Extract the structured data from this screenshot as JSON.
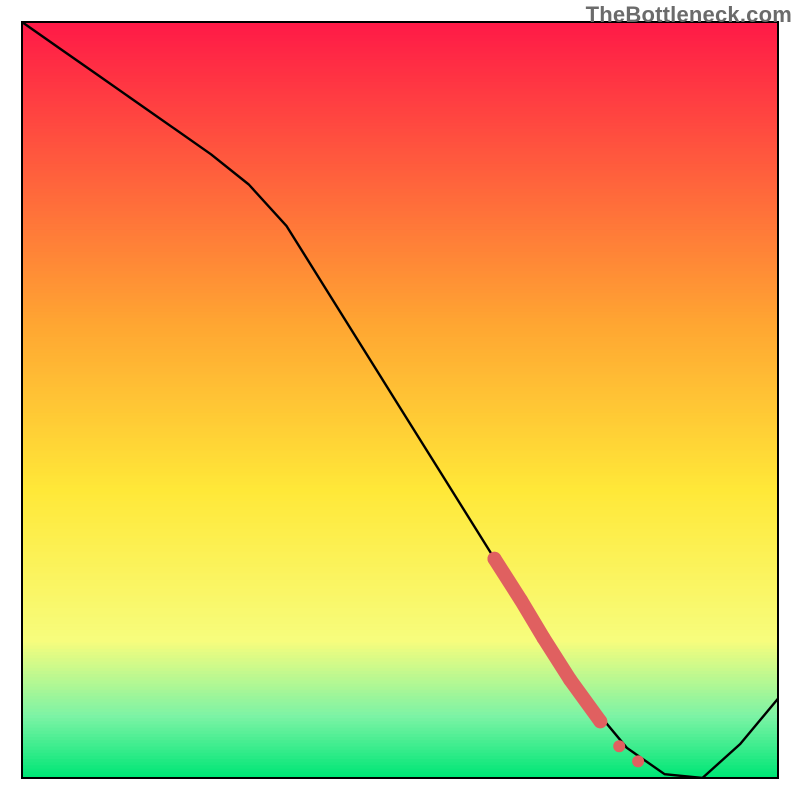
{
  "watermark": "TheBottleneck.com",
  "colors": {
    "top_red": "#ff1a47",
    "orange": "#ffa632",
    "yellow": "#ffe838",
    "pale_yellow": "#f7fd7d",
    "mint": "#7cf3a5",
    "green": "#00e676",
    "curve_stroke": "#000000",
    "marker": "#e06060",
    "border": "#000000"
  },
  "chart_data": {
    "type": "line",
    "title": "",
    "xlabel": "",
    "ylabel": "",
    "xlim": [
      0,
      100
    ],
    "ylim": [
      0,
      100
    ],
    "x": [
      0,
      5,
      10,
      15,
      20,
      25,
      30,
      35,
      40,
      45,
      50,
      55,
      60,
      65,
      70,
      75,
      80,
      85,
      90,
      95,
      100
    ],
    "series": [
      {
        "name": "bottleneck-curve",
        "values": [
          100,
          96.5,
          93,
          89.5,
          86,
          82.5,
          78.5,
          73,
          65,
          57,
          49,
          41,
          33,
          25,
          17.5,
          10,
          4,
          0.5,
          0,
          4.5,
          10.5
        ]
      }
    ],
    "markers": {
      "name": "highlight-range",
      "points": [
        {
          "x": 62.5,
          "y": 29
        },
        {
          "x": 66.0,
          "y": 23.5
        },
        {
          "x": 69.0,
          "y": 18.5
        },
        {
          "x": 72.5,
          "y": 13.0
        },
        {
          "x": 76.5,
          "y": 7.5
        },
        {
          "x": 79.0,
          "y": 4.2
        },
        {
          "x": 81.5,
          "y": 2.2
        }
      ]
    },
    "annotations": []
  }
}
